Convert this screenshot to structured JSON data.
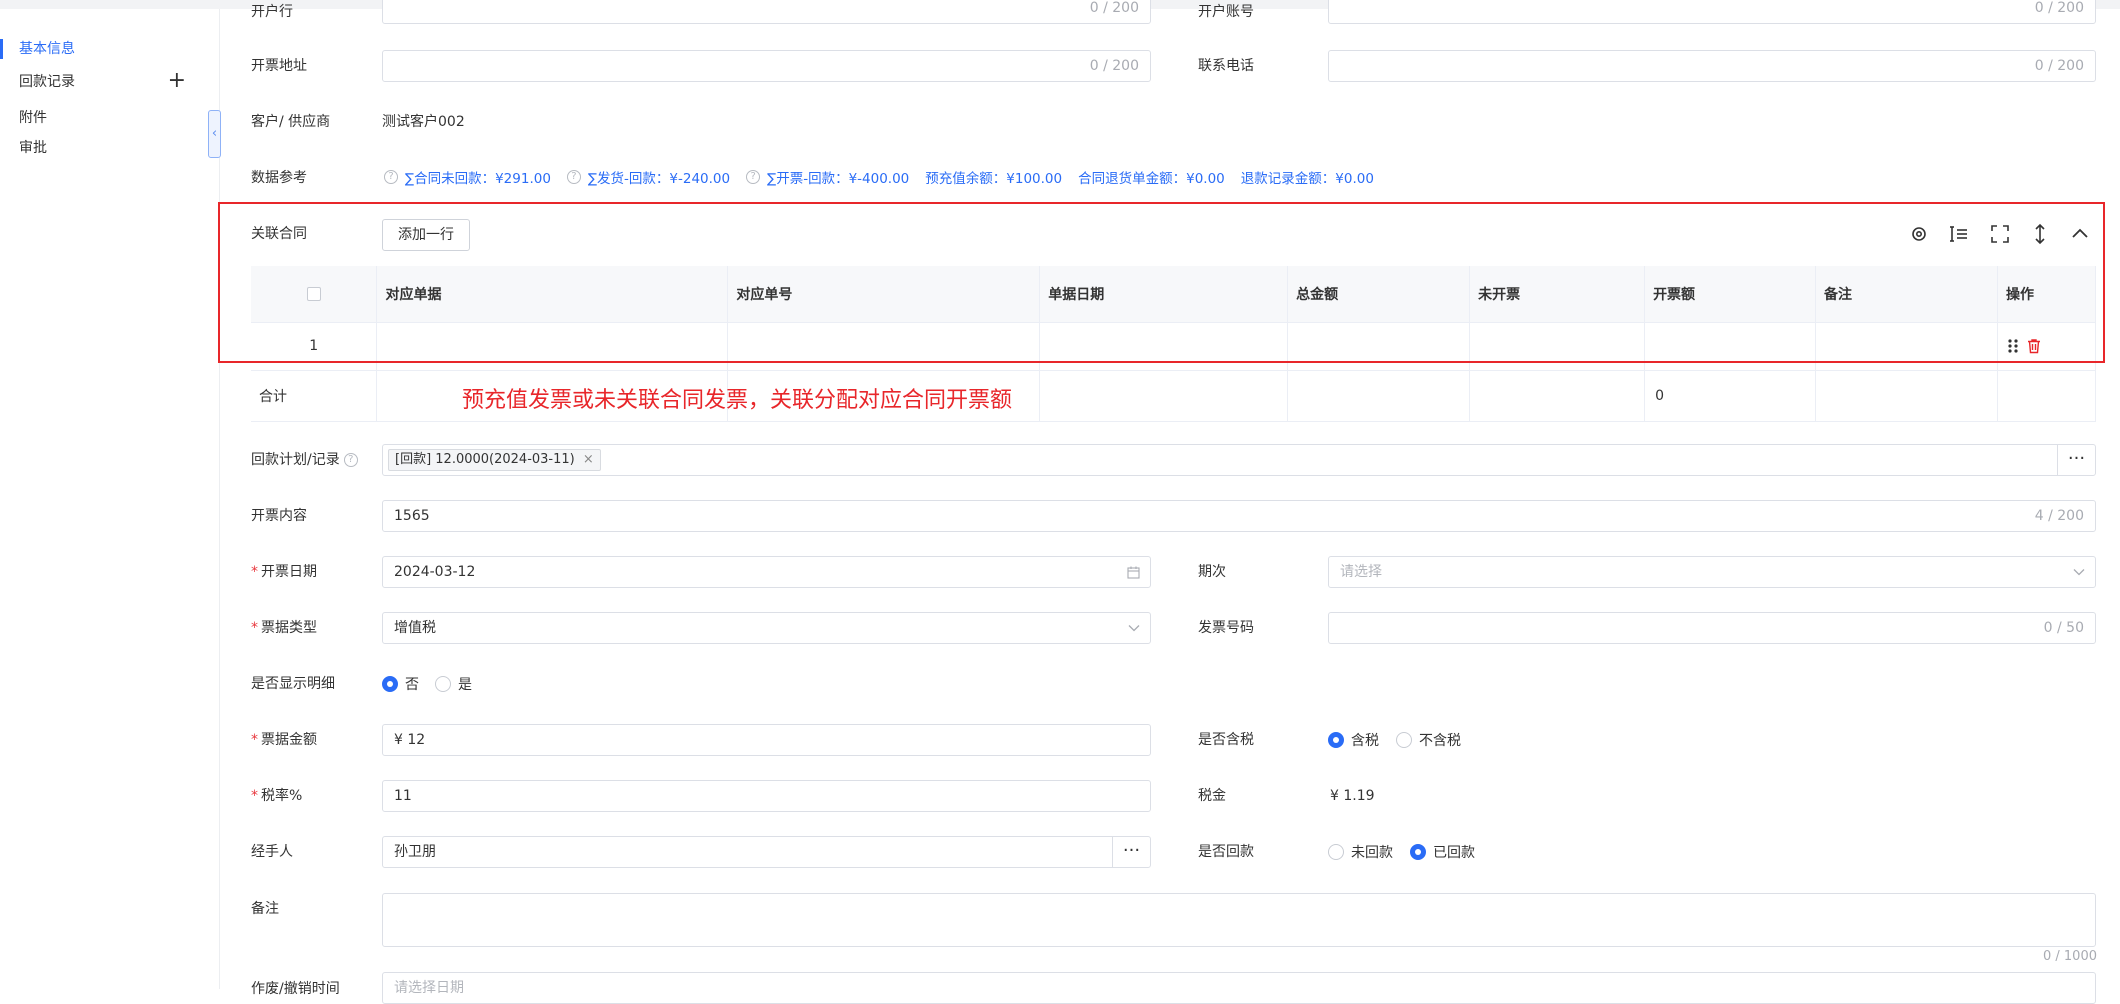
{
  "sidebar": {
    "items": [
      {
        "label": "基本信息"
      },
      {
        "label": "回款记录",
        "action": "+"
      },
      {
        "label": "附件"
      },
      {
        "label": "审批"
      }
    ],
    "collapse_glyph": "‹"
  },
  "form": {
    "bank": {
      "label": "开户行",
      "counter": "0 / 200"
    },
    "bank_account": {
      "label": "开户账号",
      "counter": "0 / 200"
    },
    "invoice_address": {
      "label": "开票地址",
      "counter": "0 / 200"
    },
    "contact_phone": {
      "label": "联系电话",
      "counter": "0 / 200"
    },
    "customer": {
      "label": "客户/ 供应商",
      "value": "测试客户002"
    },
    "data_ref": {
      "label": "数据参考",
      "items": [
        "∑合同未回款：¥291.00",
        "∑发货-回款：¥-240.00",
        "∑开票-回款：¥-400.00",
        "预充值余额：¥100.00",
        "合同退货单金额：¥0.00",
        "退款记录金额：¥0.00"
      ]
    },
    "related_contract": {
      "label": "关联合同",
      "add_row": "添加一行",
      "columns": [
        "对应单据",
        "对应单号",
        "单据日期",
        "总金额",
        "未开票",
        "开票额",
        "备注",
        "操作"
      ],
      "rows": [
        {
          "index": "1"
        }
      ],
      "total_label": "合计",
      "total_invoice": "0"
    },
    "annotation": "预充值发票或未关联合同发票，关联分配对应合同开票额",
    "repay_plan": {
      "label": "回款计划/记录",
      "tag": "[回款] 12.0000(2024-03-11)",
      "tag_close": "×",
      "more": "···"
    },
    "invoice_content": {
      "label": "开票内容",
      "value": "1565",
      "counter": "4 / 200"
    },
    "invoice_date": {
      "label": "开票日期",
      "value": "2024-03-12"
    },
    "period": {
      "label": "期次",
      "placeholder": "请选择"
    },
    "bill_type": {
      "label": "票据类型",
      "value": "增值税"
    },
    "invoice_no": {
      "label": "发票号码",
      "counter": "0 / 50"
    },
    "show_detail": {
      "label": "是否显示明细",
      "options": [
        "否",
        "是"
      ],
      "selected": "否"
    },
    "bill_amount": {
      "label": "票据金额",
      "value": "¥ 12"
    },
    "tax_included": {
      "label": "是否含税",
      "options": [
        "含税",
        "不含税"
      ],
      "selected": "含税"
    },
    "tax_rate": {
      "label": "税率%",
      "value": "11"
    },
    "tax": {
      "label": "税金",
      "value": "¥ 1.19"
    },
    "handler": {
      "label": "经手人",
      "value": "孙卫朋",
      "more": "···"
    },
    "repaid": {
      "label": "是否回款",
      "options": [
        "未回款",
        "已回款"
      ],
      "selected": "已回款"
    },
    "remark": {
      "label": "备注",
      "counter": "0 / 1000"
    },
    "void_time": {
      "label": "作废/撤销时间",
      "placeholder": "请选择日期"
    }
  },
  "colors": {
    "accent": "#2a6cf6",
    "danger": "#e8262a",
    "required": "#e8373d"
  }
}
